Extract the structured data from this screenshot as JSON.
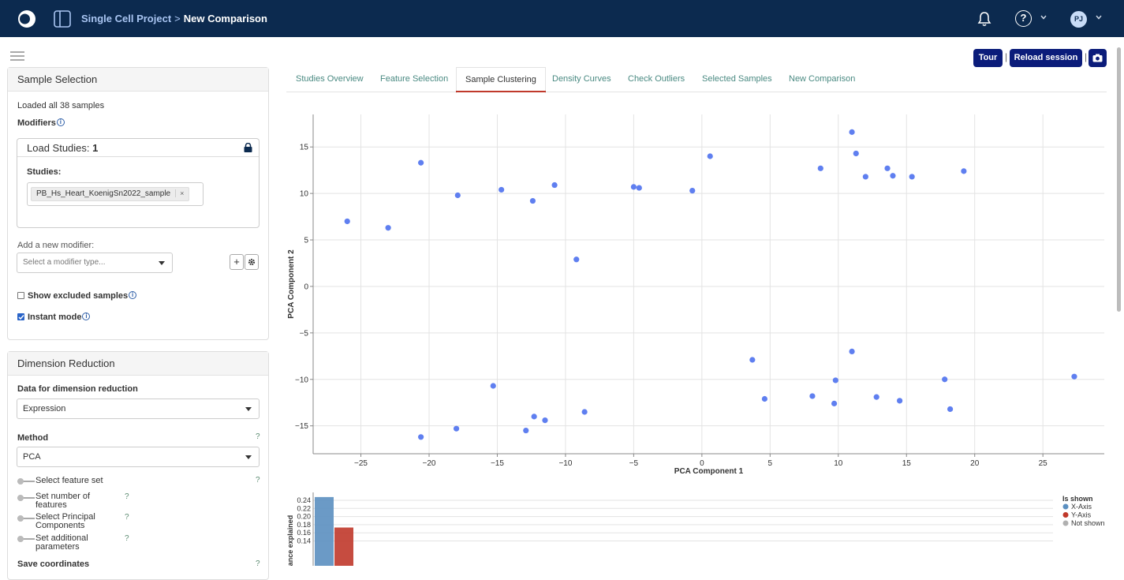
{
  "header": {
    "breadcrumb_project": "Single Cell Project",
    "breadcrumb_separator": ">",
    "breadcrumb_current": "New Comparison",
    "help_label": "?",
    "avatar_initials": "PJ"
  },
  "sample_selection": {
    "title": "Sample Selection",
    "loaded_text": "Loaded all 38 samples",
    "modifiers_label": "Modifiers",
    "load_studies_prefix": "Load Studies:",
    "load_studies_count": "1",
    "studies_label": "Studies:",
    "study_chip": "PB_Hs_Heart_KoenigSn2022_sample",
    "chip_remove": "×",
    "add_modifier_label": "Add a new modifier:",
    "modifier_placeholder": "Select a modifier type...",
    "add_button": "+",
    "show_excluded_label": "Show excluded samples",
    "instant_mode_label": "Instant mode"
  },
  "dimension_reduction": {
    "title": "Dimension Reduction",
    "data_label": "Data for dimension reduction",
    "data_value": "Expression",
    "method_label": "Method",
    "method_value": "PCA",
    "help_q": "?",
    "options": [
      {
        "line1": "Select feature set",
        "line2": ""
      },
      {
        "line1": "Set number of",
        "line2": "features"
      },
      {
        "line1": "Select Principal",
        "line2": "Components"
      },
      {
        "line1": "Set additional",
        "line2": "parameters"
      }
    ],
    "save_coordinates_label": "Save coordinates"
  },
  "tabs": [
    {
      "label": "Studies Overview",
      "active": false
    },
    {
      "label": "Feature Selection",
      "active": false
    },
    {
      "label": "Sample Clustering",
      "active": true
    },
    {
      "label": "Density Curves",
      "active": false
    },
    {
      "label": "Check Outliers",
      "active": false
    },
    {
      "label": "Selected Samples",
      "active": false
    },
    {
      "label": "New Comparison",
      "active": false
    }
  ],
  "toolbar": {
    "tour_label": "Tour",
    "reload_label": "Reload session",
    "separator": "|"
  },
  "colors": {
    "header_bg": "#0c2a4f",
    "button_bg": "#0b1c7a",
    "point": "#5f7ff0",
    "x_axis_bar": "#5b8fc0",
    "y_axis_bar": "#c0392b",
    "not_shown": "#b0b0b0",
    "active_tab_underline": "#c0392b"
  },
  "chart_data": [
    {
      "type": "scatter",
      "xlabel": "PCA Component 1",
      "ylabel": "PCA Component 2",
      "xlim": [
        -28.5,
        29.5
      ],
      "ylim": [
        -18,
        18.5
      ],
      "xticks": [
        "−25",
        "−20",
        "−15",
        "−10",
        "−5",
        "0",
        "5",
        "10",
        "15",
        "20",
        "25"
      ],
      "xtick_values": [
        -25,
        -20,
        -15,
        -10,
        -5,
        0,
        5,
        10,
        15,
        20,
        25
      ],
      "yticks": [
        "15",
        "10",
        "5",
        "0",
        "−5",
        "−10",
        "−15"
      ],
      "ytick_values": [
        15,
        10,
        5,
        0,
        -5,
        -10,
        -15
      ],
      "grid": true,
      "points": [
        [
          -26.0,
          7.0
        ],
        [
          -23.0,
          6.3
        ],
        [
          -20.6,
          13.3
        ],
        [
          -17.9,
          9.8
        ],
        [
          -14.7,
          10.4
        ],
        [
          -12.4,
          9.2
        ],
        [
          -10.8,
          10.9
        ],
        [
          -9.2,
          2.9
        ],
        [
          -5.0,
          10.7
        ],
        [
          -4.6,
          10.6
        ],
        [
          -0.7,
          10.3
        ],
        [
          0.6,
          14.0
        ],
        [
          8.7,
          12.7
        ],
        [
          11.0,
          16.6
        ],
        [
          11.3,
          14.3
        ],
        [
          12.0,
          11.8
        ],
        [
          13.6,
          12.7
        ],
        [
          14.0,
          11.9
        ],
        [
          15.4,
          11.8
        ],
        [
          19.2,
          12.4
        ],
        [
          -20.6,
          -16.2
        ],
        [
          -18.0,
          -15.3
        ],
        [
          -15.3,
          -10.7
        ],
        [
          -12.9,
          -15.5
        ],
        [
          -12.3,
          -14.0
        ],
        [
          -11.5,
          -14.4
        ],
        [
          -8.6,
          -13.5
        ],
        [
          3.7,
          -7.9
        ],
        [
          4.6,
          -12.1
        ],
        [
          8.1,
          -11.8
        ],
        [
          9.7,
          -12.6
        ],
        [
          9.8,
          -10.1
        ],
        [
          11.0,
          -7.0
        ],
        [
          12.8,
          -11.9
        ],
        [
          14.5,
          -12.3
        ],
        [
          17.8,
          -10.0
        ],
        [
          18.2,
          -13.2
        ],
        [
          27.3,
          -9.7
        ]
      ]
    },
    {
      "type": "bar",
      "ylabel": "ance explained",
      "yticks": [
        "0.24",
        "0.22",
        "0.20",
        "0.18",
        "0.16",
        "0.14"
      ],
      "ytick_values": [
        0.24,
        0.22,
        0.2,
        0.18,
        0.16,
        0.14
      ],
      "ylim": [
        0.13,
        0.245
      ],
      "values": [
        0.248,
        0.173
      ],
      "roles": [
        "x",
        "y"
      ],
      "legend": {
        "title": "Is shown",
        "items": [
          {
            "label": "X-Axis",
            "color": "#5b8fc0"
          },
          {
            "label": "Y-Axis",
            "color": "#c0392b"
          },
          {
            "label": "Not shown",
            "color": "#b0b0b0"
          }
        ]
      }
    }
  ]
}
